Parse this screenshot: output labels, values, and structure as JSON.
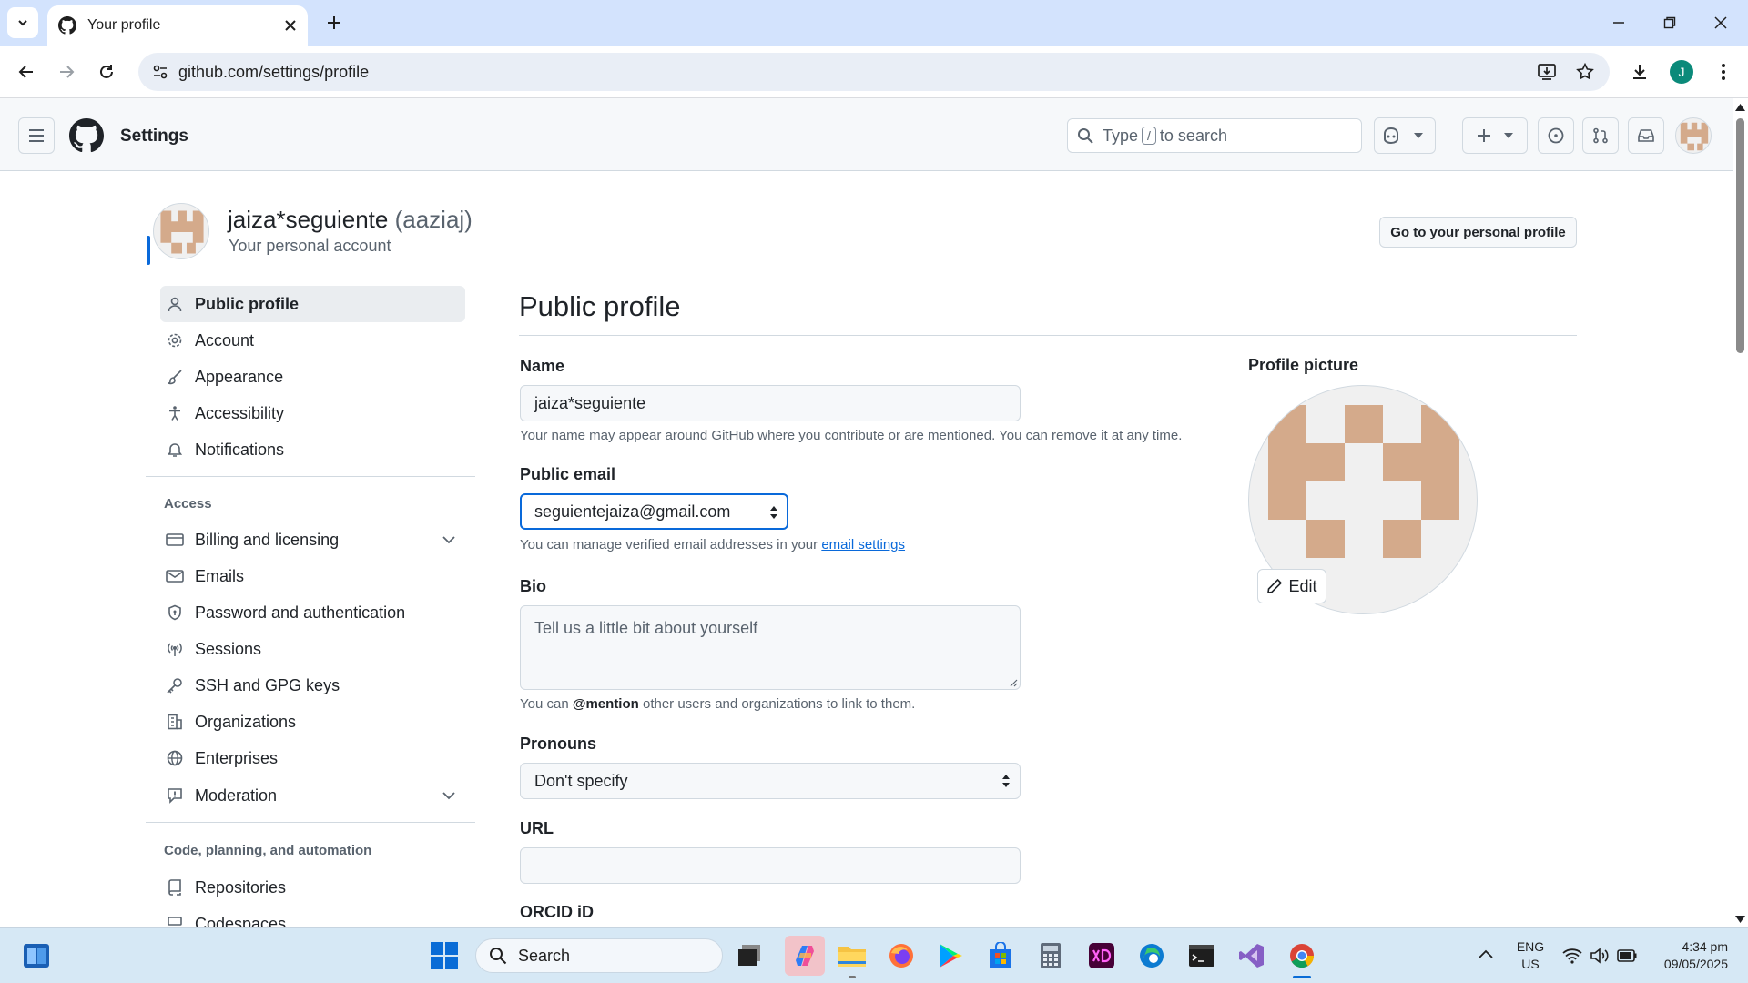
{
  "browser": {
    "tab_title": "Your profile",
    "url": "github.com/settings/profile",
    "profile_initial": "J"
  },
  "header": {
    "title": "Settings",
    "search_prefix": "Type",
    "search_key": "/",
    "search_suffix": "to search"
  },
  "account": {
    "display_name": "jaiza*seguiente",
    "username": "(aaziaj)",
    "subtitle": "Your personal account",
    "go_profile_label": "Go to your personal profile"
  },
  "sidebar": {
    "items_top": [
      {
        "label": "Public profile",
        "icon": "person-icon"
      },
      {
        "label": "Account",
        "icon": "gear-icon"
      },
      {
        "label": "Appearance",
        "icon": "paintbrush-icon"
      },
      {
        "label": "Accessibility",
        "icon": "accessibility-icon"
      },
      {
        "label": "Notifications",
        "icon": "bell-icon"
      }
    ],
    "access_heading": "Access",
    "items_access": [
      {
        "label": "Billing and licensing",
        "icon": "credit-card-icon"
      },
      {
        "label": "Emails",
        "icon": "mail-icon"
      },
      {
        "label": "Password and authentication",
        "icon": "shield-lock-icon"
      },
      {
        "label": "Sessions",
        "icon": "broadcast-icon"
      },
      {
        "label": "SSH and GPG keys",
        "icon": "key-icon"
      },
      {
        "label": "Organizations",
        "icon": "organization-icon"
      },
      {
        "label": "Enterprises",
        "icon": "globe-icon"
      },
      {
        "label": "Moderation",
        "icon": "report-icon"
      }
    ],
    "code_heading": "Code, planning, and automation",
    "items_code": [
      {
        "label": "Repositories",
        "icon": "repo-icon"
      },
      {
        "label": "Codespaces",
        "icon": "codespaces-icon"
      }
    ]
  },
  "form": {
    "page_title": "Public profile",
    "name_label": "Name",
    "name_value": "jaiza*seguiente",
    "name_note": "Your name may appear around GitHub where you contribute or are mentioned. You can remove it at any time.",
    "email_label": "Public email",
    "email_value": "seguientejaiza@gmail.com",
    "email_note_prefix": "You can manage verified email addresses in your",
    "email_note_link": "email settings",
    "bio_label": "Bio",
    "bio_placeholder": "Tell us a little bit about yourself",
    "bio_note_prefix": "You can",
    "bio_note_mention": "@mention",
    "bio_note_suffix": "other users and organizations to link to them.",
    "pronouns_label": "Pronouns",
    "pronouns_value": "Don't specify",
    "url_label": "URL",
    "url_value": "",
    "orcid_label": "ORCID iD"
  },
  "profile_picture": {
    "label": "Profile picture",
    "edit_label": "Edit"
  },
  "taskbar": {
    "search_placeholder": "Search",
    "lang_top": "ENG",
    "lang_bottom": "US",
    "time": "4:34 pm",
    "date": "09/05/2025"
  },
  "colors": {
    "accent": "#0969da",
    "avatar": "#d4aa8b",
    "active_bar": "#0969da"
  }
}
